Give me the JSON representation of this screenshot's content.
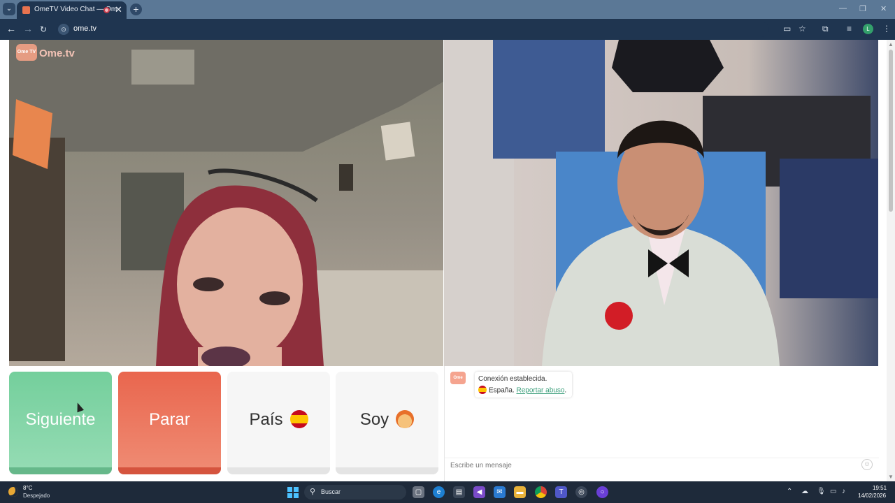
{
  "browser": {
    "tab_title": "OmeTV Video Chat — Ome",
    "tab_close": "✕",
    "tab_menu": "⌄",
    "new_tab": "+",
    "window_controls": [
      "—",
      "❐",
      "✕"
    ],
    "url": "ome.tv",
    "site_icon": "⊙"
  },
  "page": {
    "brand": {
      "tv_label": "Ome TV",
      "text": "Ome.tv"
    },
    "controls": {
      "next_label": "Siguiente",
      "stop_label": "Parar",
      "country_label": "País",
      "iam_label": "Soy"
    },
    "chat": {
      "avatar_label": "Ome TV",
      "status": "Conexión establecida.",
      "country": "España.",
      "report_link": "Reportar abuso",
      "report_suffix": ".",
      "input_placeholder": "Escribe un mensaje",
      "emoji_button": "☺"
    }
  },
  "taskbar": {
    "weather_temp": "8°C",
    "weather_condition": "Despejado",
    "search_label": "Buscar",
    "search_icon": "⚲",
    "time": "19:51",
    "date": "14/02/2026",
    "tray_up": "⌃"
  },
  "colors": {
    "next_button": "#74cf9c",
    "stop_button": "#e9664e",
    "report_link": "#3a9e7a",
    "tab_strip": "#5b7896",
    "toolbar": "#1f3550",
    "taskbar": "#1e2a3a"
  }
}
